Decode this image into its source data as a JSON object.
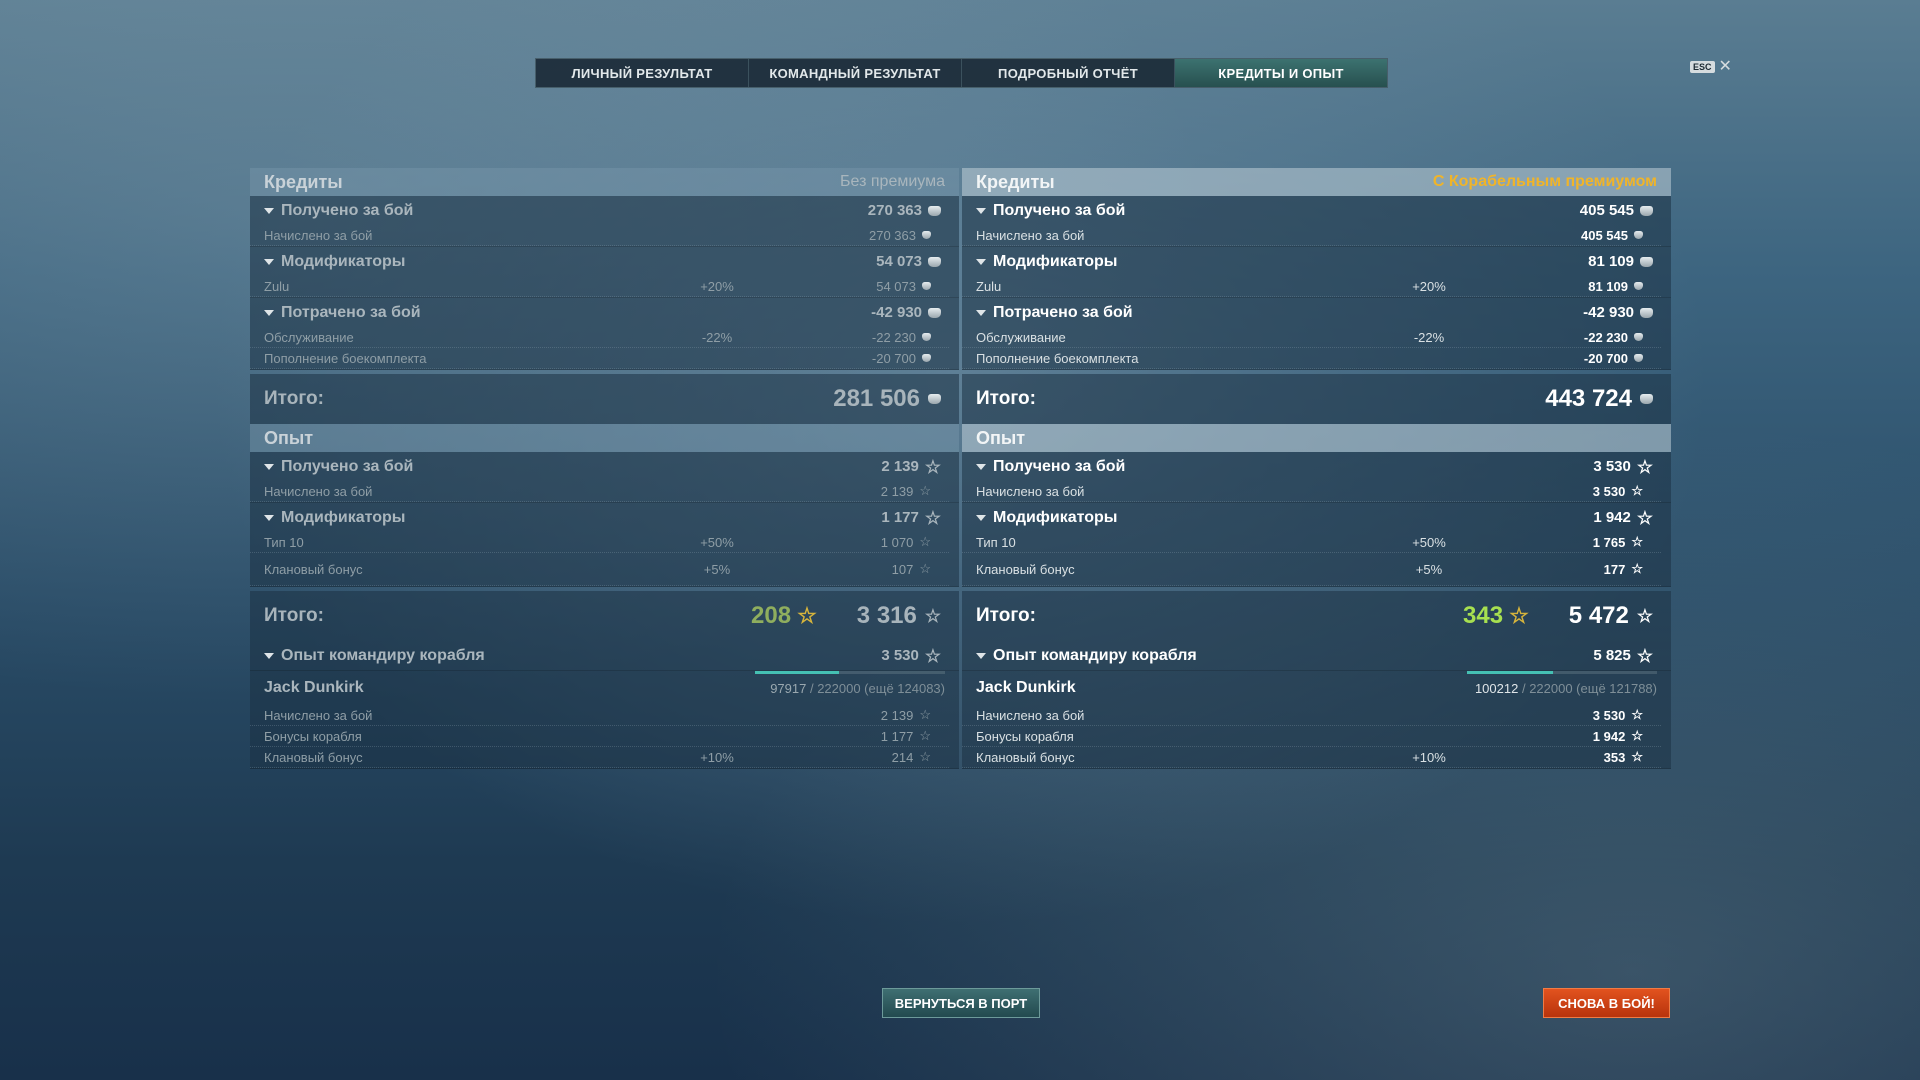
{
  "tabs": [
    {
      "label": "ЛИЧНЫЙ РЕЗУЛЬТАТ",
      "active": false
    },
    {
      "label": "КОМАНДНЫЙ РЕЗУЛЬТАТ",
      "active": false
    },
    {
      "label": "ПОДРОБНЫЙ ОТЧЁТ",
      "active": false
    },
    {
      "label": "КРЕДИТЫ И ОПЫТ",
      "active": true
    }
  ],
  "esc": {
    "key": "ESC",
    "close": "✕"
  },
  "left": {
    "credits": {
      "title": "Кредиты",
      "subtitle": "Без премиума",
      "earned": {
        "label": "Получено за бой",
        "value": "270 363"
      },
      "earned_items": [
        {
          "label": "Начислено за бой",
          "pct": "",
          "value": "270 363"
        }
      ],
      "modifiers": {
        "label": "Модификаторы",
        "value": "54 073"
      },
      "modifier_items": [
        {
          "label": "Zulu",
          "pct": "+20%",
          "value": "54 073"
        }
      ],
      "spent": {
        "label": "Потрачено за бой",
        "value": "-42 930"
      },
      "spent_items": [
        {
          "label": "Обслуживание",
          "pct": "-22%",
          "value": "-22 230"
        },
        {
          "label": "Пополнение боекомплекта",
          "pct": "",
          "value": "-20 700"
        }
      ],
      "total_label": "Итого:",
      "total": "281 506"
    },
    "xp": {
      "title": "Опыт",
      "earned": {
        "label": "Получено за бой",
        "value": "2 139"
      },
      "earned_items": [
        {
          "label": "Начислено за бой",
          "pct": "",
          "value": "2 139"
        }
      ],
      "modifiers": {
        "label": "Модификаторы",
        "value": "1 177"
      },
      "modifier_items": [
        {
          "label": "Тип 10",
          "pct": "+50%",
          "value": "1 070"
        },
        {
          "label": "Клановый бонус",
          "pct": "+5%",
          "value": "107"
        }
      ],
      "total_label": "Итого:",
      "bonus": "208",
      "total": "3 316",
      "commander": {
        "label": "Опыт командиру корабля",
        "value": "3 530"
      },
      "commander_name": "Jack Dunkirk",
      "commander_xp": "97917",
      "commander_max": "/ 222000 (ещё 124083)",
      "commander_progress": 0.44,
      "commander_items": [
        {
          "label": "Начислено за бой",
          "pct": "",
          "value": "2 139"
        },
        {
          "label": "Бонусы корабля",
          "pct": "",
          "value": "1 177"
        },
        {
          "label": "Клановый бонус",
          "pct": "+10%",
          "value": "214"
        }
      ]
    }
  },
  "right": {
    "credits": {
      "title": "Кредиты",
      "subtitle": "С Корабельным премиумом",
      "earned": {
        "label": "Получено за бой",
        "value": "405 545"
      },
      "earned_items": [
        {
          "label": "Начислено за бой",
          "pct": "",
          "value": "405 545"
        }
      ],
      "modifiers": {
        "label": "Модификаторы",
        "value": "81 109"
      },
      "modifier_items": [
        {
          "label": "Zulu",
          "pct": "+20%",
          "value": "81 109"
        }
      ],
      "spent": {
        "label": "Потрачено за бой",
        "value": "-42 930"
      },
      "spent_items": [
        {
          "label": "Обслуживание",
          "pct": "-22%",
          "value": "-22 230"
        },
        {
          "label": "Пополнение боекомплекта",
          "pct": "",
          "value": "-20 700"
        }
      ],
      "total_label": "Итого:",
      "total": "443 724"
    },
    "xp": {
      "title": "Опыт",
      "earned": {
        "label": "Получено за бой",
        "value": "3 530"
      },
      "earned_items": [
        {
          "label": "Начислено за бой",
          "pct": "",
          "value": "3 530"
        }
      ],
      "modifiers": {
        "label": "Модификаторы",
        "value": "1 942"
      },
      "modifier_items": [
        {
          "label": "Тип 10",
          "pct": "+50%",
          "value": "1 765"
        },
        {
          "label": "Клановый бонус",
          "pct": "+5%",
          "value": "177"
        }
      ],
      "total_label": "Итого:",
      "bonus": "343",
      "total": "5 472",
      "commander": {
        "label": "Опыт командиру корабля",
        "value": "5 825"
      },
      "commander_name": "Jack Dunkirk",
      "commander_xp": "100212",
      "commander_max": "/ 222000 (ещё 121788)",
      "commander_progress": 0.45,
      "commander_items": [
        {
          "label": "Начислено за бой",
          "pct": "",
          "value": "3 530"
        },
        {
          "label": "Бонусы корабля",
          "pct": "",
          "value": "1 942"
        },
        {
          "label": "Клановый бонус",
          "pct": "+10%",
          "value": "353"
        }
      ]
    }
  },
  "buttons": {
    "port": "ВЕРНУТЬСЯ В ПОРТ",
    "battle": "СНОВА В БОЙ!"
  },
  "colors": {
    "accent_teal": "#45c0b3",
    "premium_gold": "#f0b429",
    "battle_orange": "#e2531f",
    "bonus_green": "#a7e050"
  }
}
